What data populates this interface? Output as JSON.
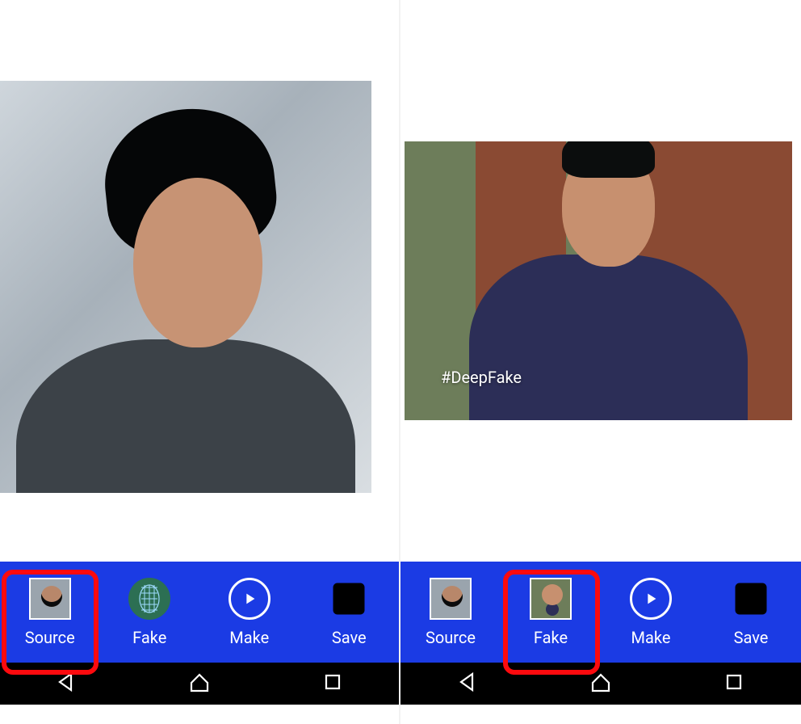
{
  "left": {
    "actions": {
      "source": "Source",
      "fake": "Fake",
      "make": "Make",
      "save": "Save"
    },
    "highlighted_action": "source"
  },
  "right": {
    "actions": {
      "source": "Source",
      "fake": "Fake",
      "make": "Make",
      "save": "Save"
    },
    "highlighted_action": "fake",
    "image_caption": "#DeepFake"
  },
  "icons": {
    "fake_mask": "face-mask-icon",
    "make_play": "play-icon",
    "save_exit": "save-icon",
    "nav_back": "back-icon",
    "nav_home": "home-icon",
    "nav_recent": "recent-icon"
  },
  "colors": {
    "action_bar": "#1b3be4",
    "highlight": "#fc0a0e",
    "mask_bg": "#2c6f53"
  }
}
